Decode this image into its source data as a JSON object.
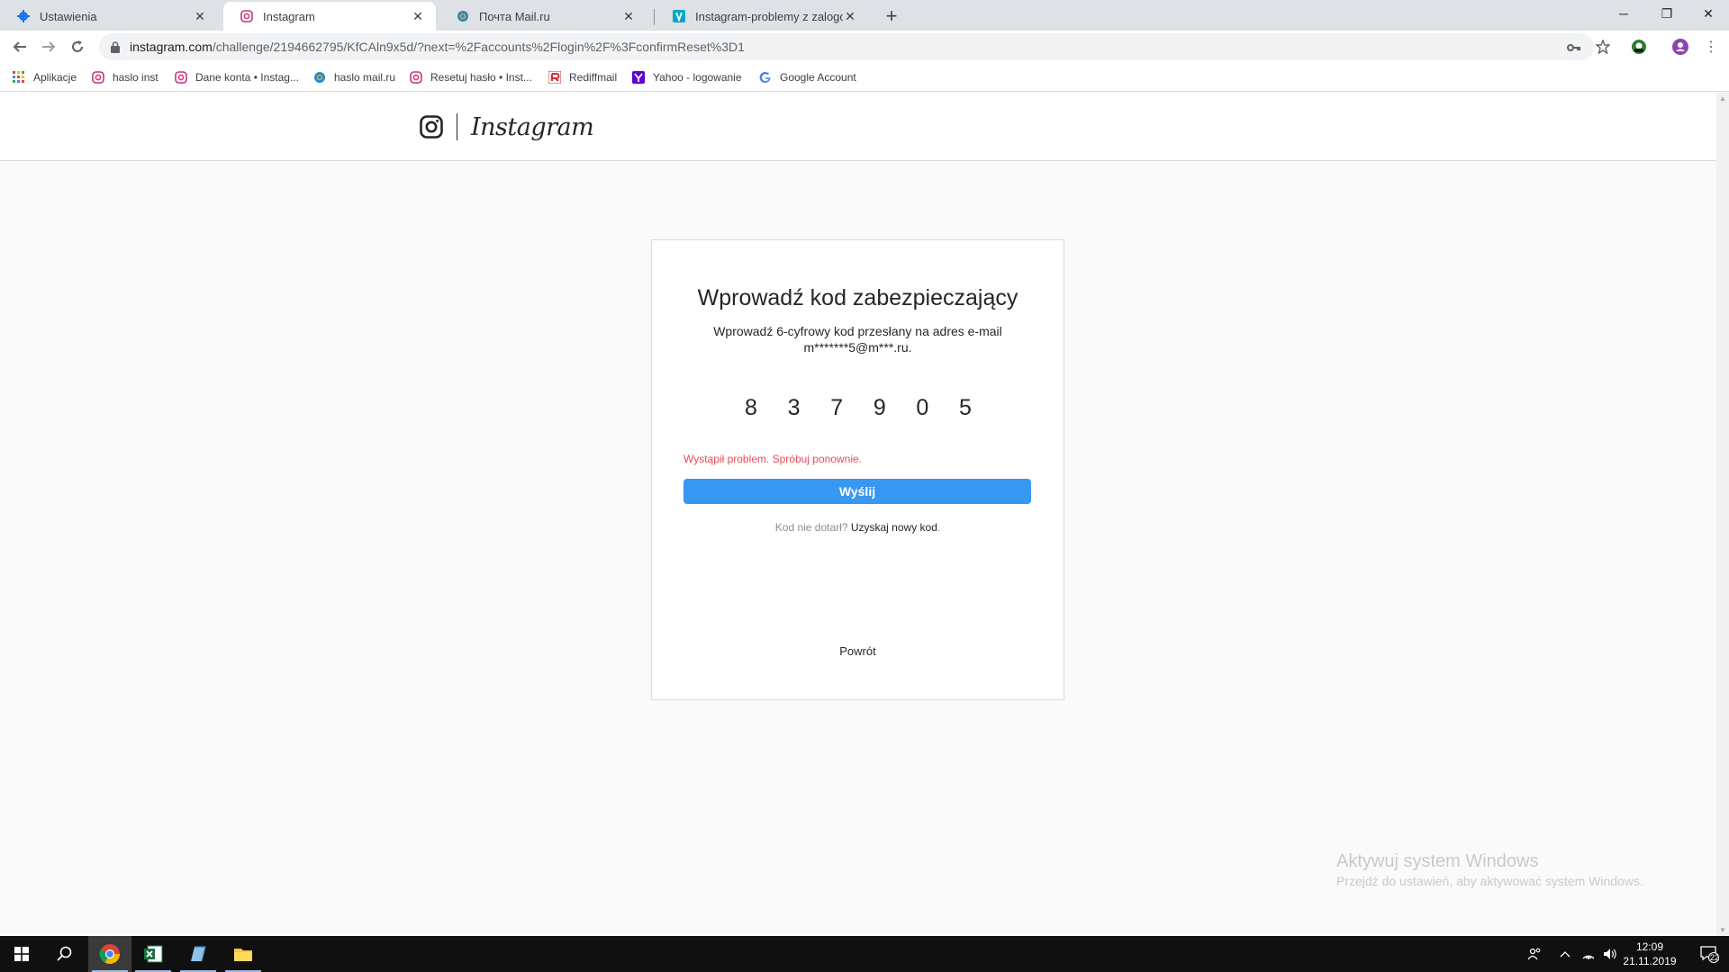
{
  "browser": {
    "tabs": [
      {
        "label": "Ustawienia",
        "icon": "gear-icon"
      },
      {
        "label": "Instagram",
        "icon": "instagram-icon",
        "active": true
      },
      {
        "label": "Почта Mail.ru",
        "icon": "mailru-icon"
      },
      {
        "label": "Instagram-problemy z zalogowaniem",
        "icon": "v-site-icon"
      }
    ],
    "url_host": "instagram.com",
    "url_path": "/challenge/2194662795/KfCAln9x5d/?next=%2Faccounts%2Flogin%2F%3FconfirmReset%3D1",
    "bookmarks": [
      {
        "label": "Aplikacje",
        "icon": "apps-grid-icon"
      },
      {
        "label": "haslo inst",
        "icon": "instagram-icon"
      },
      {
        "label": "Dane konta • Instag...",
        "icon": "instagram-icon"
      },
      {
        "label": "haslo mail.ru",
        "icon": "mailru-icon"
      },
      {
        "label": "Resetuj hasło • Inst...",
        "icon": "instagram-icon"
      },
      {
        "label": "Rediffmail",
        "icon": "rediffmail-icon"
      },
      {
        "label": "Yahoo - logowanie",
        "icon": "yahoo-icon"
      },
      {
        "label": "Google Account",
        "icon": "google-icon"
      }
    ]
  },
  "header": {
    "wordmark": "Instagram"
  },
  "card": {
    "title": "Wprowadź kod zabezpieczający",
    "subtitle": "Wprowadź 6-cyfrowy kod przesłany na adres e-mail m*******5@m***.ru.",
    "code": [
      "8",
      "3",
      "7",
      "9",
      "0",
      "5"
    ],
    "error": "Wystąpił problem. Spróbuj ponownie.",
    "submit_label": "Wyślij",
    "resend_prompt": "Kod nie dotarł?",
    "resend_link": "Uzyskaj nowy kod",
    "resend_end": ".",
    "back_label": "Powrót"
  },
  "watermark": {
    "title": "Aktywuj system Windows",
    "subtitle": "Przejdź do ustawień, aby aktywować system Windows."
  },
  "taskbar": {
    "time": "12:09",
    "date": "21.11.2019",
    "notifications": "22"
  },
  "colors": {
    "accent": "#3897f0",
    "error": "#ed4956",
    "border": "#dbdbdb"
  }
}
